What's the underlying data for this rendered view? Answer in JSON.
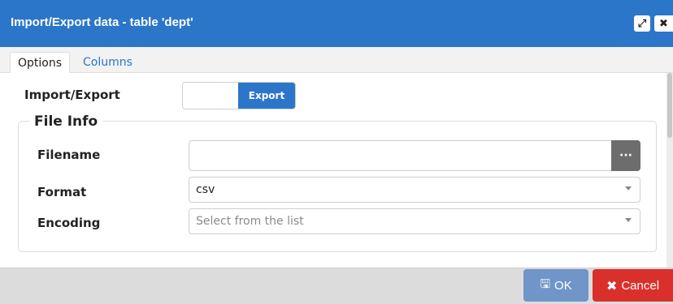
{
  "window": {
    "title": "Import/Export data - table 'dept'",
    "expand_icon": "expand-icon",
    "close_icon": "close-icon",
    "accent_color": "#2c76c9"
  },
  "tabs": [
    {
      "label": "Options",
      "active": true
    },
    {
      "label": "Columns",
      "active": false
    }
  ],
  "options": {
    "import_export": {
      "label": "Import/Export",
      "value": "Export"
    },
    "file_info": {
      "legend": "File Info",
      "filename": {
        "label": "Filename",
        "value": "",
        "browse_label": "···"
      },
      "format": {
        "label": "Format",
        "value": "csv"
      },
      "encoding": {
        "label": "Encoding",
        "placeholder": "Select from the list"
      }
    }
  },
  "footer": {
    "ok_label": "OK",
    "cancel_label": "Cancel",
    "ok_color": "#6f95c9",
    "cancel_color": "#d9302c"
  }
}
